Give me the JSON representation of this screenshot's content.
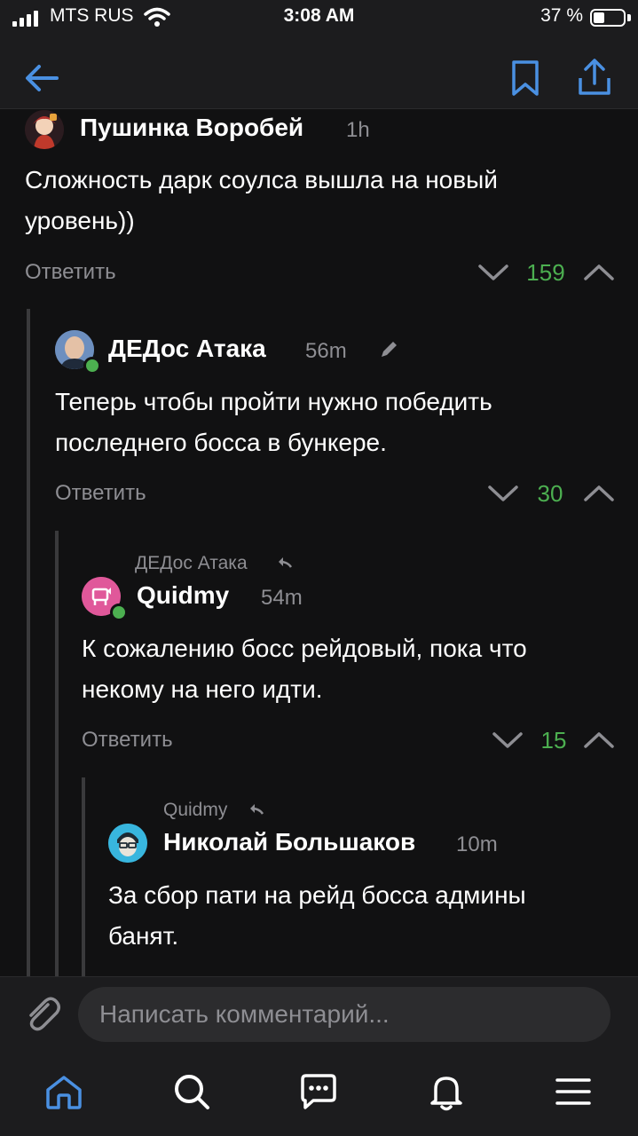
{
  "status_bar": {
    "carrier": "MTS RUS",
    "time": "3:08 AM",
    "battery": "37 %"
  },
  "nav": {
    "back_icon": "arrow-left-icon",
    "bookmark_icon": "bookmark-icon",
    "share_icon": "share-icon"
  },
  "colors": {
    "accent": "#4a90e2",
    "score_green": "#4caf50",
    "muted": "#8e8e93",
    "background": "#111112"
  },
  "comments": [
    {
      "author": "Пушинка Воробей",
      "time": "1h",
      "text_lines": [
        "Сложность дарк соулса вышла на новый",
        "уровень))"
      ],
      "reply_label": "Ответить",
      "score": "159"
    },
    {
      "author": "ДЕДос Атака",
      "time": "56m",
      "text_lines": [
        "Теперь чтобы пройти нужно победить",
        "последнего босса в бункере."
      ],
      "reply_label": "Ответить",
      "score": "30"
    },
    {
      "reply_to": "ДЕДос Атака",
      "author": "Quidmy",
      "time": "54m",
      "text_lines": [
        "К сожалению босс рейдовый, пока что",
        "некому на него идти."
      ],
      "reply_label": "Ответить",
      "score": "15"
    },
    {
      "reply_to": "Quidmy",
      "author": "Николай Большаков",
      "time": "10m",
      "text_lines": [
        "За сбор пати на рейд босса админы",
        "банят."
      ]
    }
  ],
  "composer": {
    "placeholder": "Написать комментарий..."
  },
  "tabs": [
    "home-icon",
    "search-icon",
    "messages-icon",
    "notifications-icon",
    "menu-icon"
  ]
}
